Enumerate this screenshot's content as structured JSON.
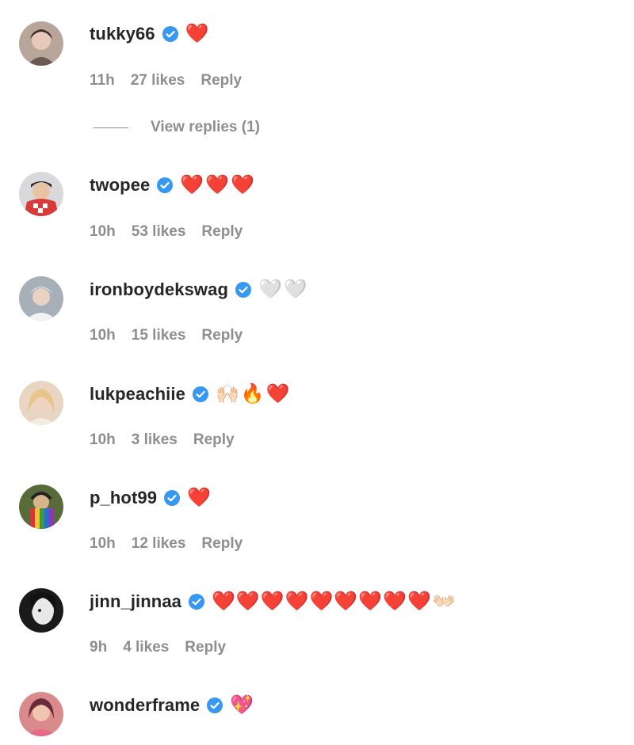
{
  "comments": [
    {
      "username": "tukky66",
      "text": "❤️",
      "time": "11h",
      "likes": "27 likes",
      "reply": "Reply",
      "view_replies": "View replies (1)"
    },
    {
      "username": "twopee",
      "text": "❤️❤️❤️",
      "time": "10h",
      "likes": "53 likes",
      "reply": "Reply"
    },
    {
      "username": "ironboydekswag",
      "text": "🤍🤍",
      "time": "10h",
      "likes": "15 likes",
      "reply": "Reply"
    },
    {
      "username": "lukpeachiie",
      "text": "🙌🏻🔥❤️",
      "time": "10h",
      "likes": "3 likes",
      "reply": "Reply"
    },
    {
      "username": "p_hot99",
      "text": "❤️",
      "time": "10h",
      "likes": "12 likes",
      "reply": "Reply"
    },
    {
      "username": "jinn_jinnaa",
      "text": "❤️❤️❤️❤️❤️❤️❤️❤️❤️👐🏻",
      "time": "9h",
      "likes": "4 likes",
      "reply": "Reply"
    },
    {
      "username": "wonderframe",
      "text": "💖"
    }
  ],
  "colors": {
    "text": "#262626",
    "muted": "#8e8e8e",
    "verified": "#3897f0",
    "heart": "#e8192c"
  },
  "icons": {
    "verified": "verified-badge-icon"
  }
}
